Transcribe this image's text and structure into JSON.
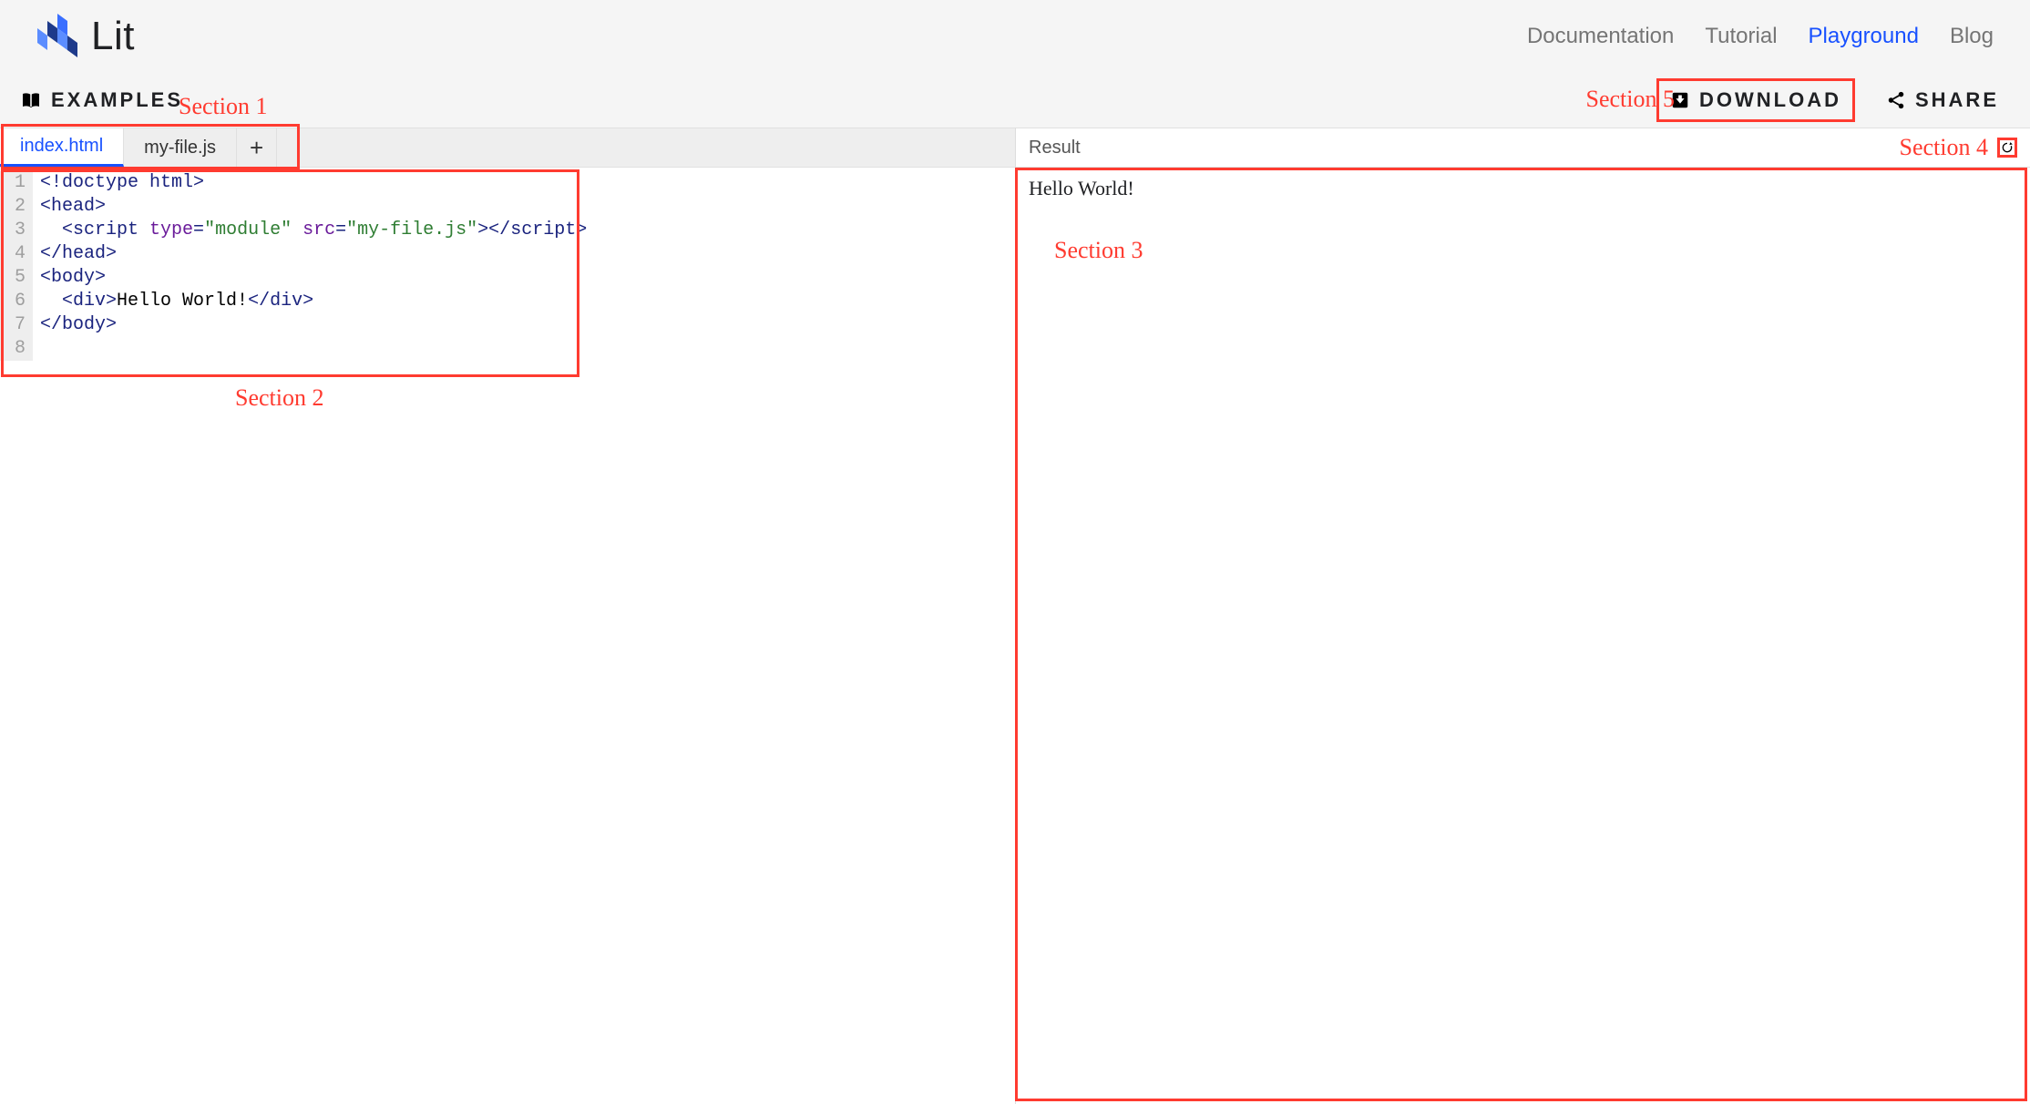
{
  "brand": {
    "name": "Lit"
  },
  "nav": {
    "items": [
      {
        "label": "Documentation",
        "active": false
      },
      {
        "label": "Tutorial",
        "active": false
      },
      {
        "label": "Playground",
        "active": true
      },
      {
        "label": "Blog",
        "active": false
      }
    ]
  },
  "toolbar": {
    "examples_label": "EXAMPLES",
    "download_label": "DOWNLOAD",
    "share_label": "SHARE"
  },
  "tabs": {
    "items": [
      {
        "label": "index.html",
        "active": true
      },
      {
        "label": "my-file.js",
        "active": false
      }
    ],
    "add_label": "+"
  },
  "editor": {
    "lines": [
      [
        {
          "cls": "tok-doctype",
          "t": "<!doctype html>"
        }
      ],
      [
        {
          "cls": "tok-tag",
          "t": "<head>"
        }
      ],
      [
        {
          "cls": "tok-txt",
          "t": "  "
        },
        {
          "cls": "tok-tag",
          "t": "<script "
        },
        {
          "cls": "tok-attr",
          "t": "type"
        },
        {
          "cls": "tok-tag",
          "t": "="
        },
        {
          "cls": "tok-str",
          "t": "\"module\""
        },
        {
          "cls": "tok-tag",
          "t": " "
        },
        {
          "cls": "tok-attr",
          "t": "src"
        },
        {
          "cls": "tok-tag",
          "t": "="
        },
        {
          "cls": "tok-str",
          "t": "\"my-file.js\""
        },
        {
          "cls": "tok-tag",
          "t": ">"
        },
        {
          "cls": "tok-tag",
          "t": "</"
        },
        {
          "cls": "tok-tag",
          "t": "script>"
        }
      ],
      [
        {
          "cls": "tok-tag",
          "t": "</head>"
        }
      ],
      [
        {
          "cls": "tok-tag",
          "t": "<body>"
        }
      ],
      [
        {
          "cls": "tok-txt",
          "t": "  "
        },
        {
          "cls": "tok-tag",
          "t": "<div>"
        },
        {
          "cls": "tok-txt",
          "t": "Hello World!"
        },
        {
          "cls": "tok-tag",
          "t": "</div>"
        }
      ],
      [
        {
          "cls": "tok-tag",
          "t": "</body>"
        }
      ],
      [
        {
          "cls": "tok-txt",
          "t": ""
        }
      ]
    ]
  },
  "result": {
    "header": "Result",
    "output": "Hello World!"
  },
  "annotations": {
    "s1": "Section 1",
    "s2": "Section 2",
    "s3": "Section 3",
    "s4": "Section 4",
    "s5": "Section 5"
  }
}
